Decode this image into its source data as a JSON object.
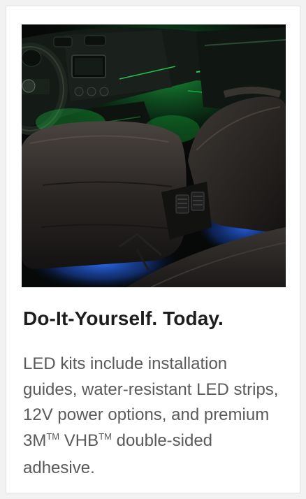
{
  "card": {
    "image_alt": "Car interior lit with green dashboard and blue footwell LED lighting",
    "title": "Do-It-Yourself. Today.",
    "description_parts": {
      "part1": "LED kits include installation guides, water-resistant LED strips, 12V power options, and premium 3M",
      "tm1": "TM",
      "part2": " VHB",
      "tm2": "TM",
      "part3": " double-sided adhesive."
    }
  },
  "colors": {
    "green_glow": "#1fd14a",
    "blue_glow": "#1e5bd8",
    "title_text": "#1d1d1d",
    "body_text": "#5a5a5a"
  }
}
